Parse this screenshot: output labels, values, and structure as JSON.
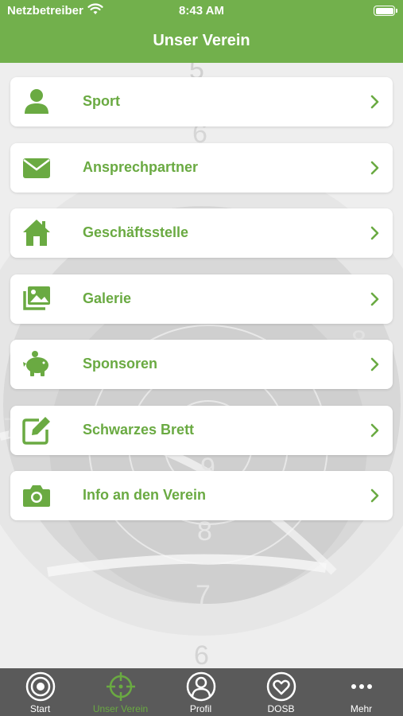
{
  "status_bar": {
    "carrier": "Netzbetreiber",
    "time": "8:43 AM"
  },
  "header": {
    "title": "Unser Verein"
  },
  "menu": [
    {
      "label": "Sport",
      "icon": "person-icon"
    },
    {
      "label": "Ansprechpartner",
      "icon": "envelope-icon"
    },
    {
      "label": "Geschäftsstelle",
      "icon": "house-icon"
    },
    {
      "label": "Galerie",
      "icon": "gallery-icon"
    },
    {
      "label": "Sponsoren",
      "icon": "piggy-bank-icon"
    },
    {
      "label": "Schwarzes Brett",
      "icon": "edit-icon"
    },
    {
      "label": "Info an den Verein",
      "icon": "camera-icon"
    }
  ],
  "tabs": [
    {
      "label": "Start",
      "icon": "target-icon",
      "active": false
    },
    {
      "label": "Unser Verein",
      "icon": "crosshair-icon",
      "active": true
    },
    {
      "label": "Profil",
      "icon": "profile-icon",
      "active": false
    },
    {
      "label": "DOSB",
      "icon": "heart-icon",
      "active": false
    },
    {
      "label": "Mehr",
      "icon": "more-dots-icon",
      "active": false
    }
  ],
  "background_numbers": [
    "5",
    "6",
    "8",
    "9",
    "8",
    "7",
    "6",
    "7"
  ],
  "colors": {
    "accent": "#72b04c",
    "label": "#6aaa42",
    "tabbar": "#5a5a5a"
  }
}
